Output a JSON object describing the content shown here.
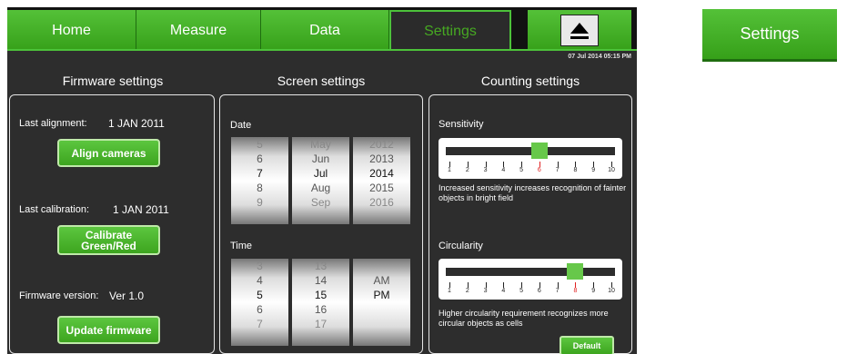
{
  "tabs": [
    {
      "label": "Home"
    },
    {
      "label": "Measure"
    },
    {
      "label": "Data"
    },
    {
      "label": "Settings",
      "active": true
    }
  ],
  "eject_icon": "eject-icon",
  "datetime": "07 Jul 2014  05:15 PM",
  "firmware": {
    "title": "Firmware settings",
    "last_alignment_label": "Last alignment:",
    "last_alignment_value": "1 JAN 2011",
    "align_button": "Align cameras",
    "last_calibration_label": "Last calibration:",
    "last_calibration_value": "1 JAN 2011",
    "calibrate_button_line1": "Calibrate",
    "calibrate_button_line2": "Green/Red",
    "version_label": "Firmware version:",
    "version_value": "Ver 1.0",
    "update_button": "Update firmware"
  },
  "screen": {
    "title": "Screen settings",
    "date_label": "Date",
    "date_wheels": [
      [
        "5",
        "6",
        "7",
        "8",
        "9"
      ],
      [
        "May",
        "Jun",
        "Jul",
        "Aug",
        "Sep"
      ],
      [
        "2012",
        "2013",
        "2014",
        "2015",
        "2016"
      ]
    ],
    "time_label": "Time",
    "time_wheels": [
      [
        "3",
        "4",
        "5",
        "6",
        "7"
      ],
      [
        "13",
        "14",
        "15",
        "16",
        "17"
      ],
      [
        "",
        "AM",
        "PM",
        "",
        ""
      ]
    ]
  },
  "counting": {
    "title": "Counting settings",
    "sensitivity_label": "Sensitivity",
    "sensitivity_value": 6,
    "sensitivity_desc": "Increased sensitivity increases recognition of fainter objects in bright field",
    "circularity_label": "Circularity",
    "circularity_value": 8,
    "circularity_desc": "Higher circularity requirement recognizes more circular objects as cells",
    "ticks": [
      "1",
      "2",
      "3",
      "4",
      "5",
      "6",
      "7",
      "8",
      "9",
      "10"
    ],
    "default_button": "Default"
  },
  "crop_tab_label": "Settings",
  "colors": {
    "accent_green": "#4cc23a",
    "panel_bg": "#2d2d2d",
    "selected_tick": "#e02020"
  }
}
